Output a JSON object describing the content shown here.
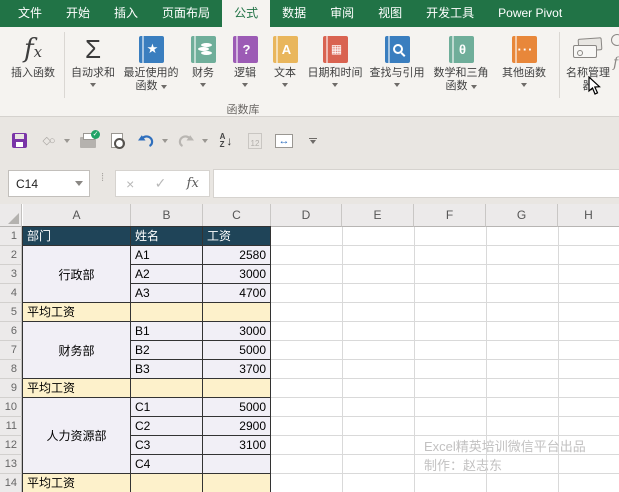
{
  "tab_bar": {
    "tabs": [
      {
        "label": "文件",
        "selected": false
      },
      {
        "label": "开始",
        "selected": false
      },
      {
        "label": "插入",
        "selected": false
      },
      {
        "label": "页面布局",
        "selected": false
      },
      {
        "label": "公式",
        "selected": true
      },
      {
        "label": "数据",
        "selected": false
      },
      {
        "label": "审阅",
        "selected": false
      },
      {
        "label": "视图",
        "selected": false
      },
      {
        "label": "开发工具",
        "selected": false
      },
      {
        "label": "Power Pivot",
        "selected": false
      }
    ]
  },
  "ribbon": {
    "group_label": "函数库",
    "buttons": {
      "insert_function": "插入函数",
      "autosum": "自动求和",
      "recent": "最近使用的函数",
      "financial": "财务",
      "logical": "逻辑",
      "text": "文本",
      "datetime": "日期和时间",
      "lookup": "查找与引用",
      "math": "数学和三角函数",
      "more": "其他函数",
      "name_manager": "名称管理器"
    },
    "icons": [
      "fx-icon",
      "sigma-autosum-icon",
      "book-star-icon",
      "book-coins-icon",
      "book-question-icon",
      "book-letter-a-icon",
      "book-calendar-icon",
      "book-magnifier-icon",
      "book-theta-icon",
      "book-ellipsis-icon",
      "name-tags-icon"
    ]
  },
  "quick_access": {
    "icons": [
      "save-icon",
      "shapes-icon",
      "print-icon",
      "print-preview-icon",
      "undo-icon",
      "redo-icon",
      "sort-az-icon",
      "paste-number-icon",
      "column-width-icon",
      "customize-toolbar-icon"
    ]
  },
  "formula_bar": {
    "name_box": "C14",
    "formula": "",
    "fx_label": "fx",
    "cancel_glyph": "×",
    "enter_glyph": "✓"
  },
  "grid": {
    "column_headers": [
      "A",
      "B",
      "C",
      "D",
      "E",
      "F",
      "G",
      "H"
    ],
    "row_headers": [
      "1",
      "2",
      "3",
      "4",
      "5",
      "6",
      "7",
      "8",
      "9",
      "10",
      "11",
      "12",
      "13",
      "14"
    ]
  },
  "sheet": {
    "table_headers": {
      "department": "部门",
      "name": "姓名",
      "salary": "工资"
    },
    "average_label": "平均工资",
    "groups": [
      {
        "department": "行政部",
        "employees": [
          {
            "name": "A1",
            "salary": "2580"
          },
          {
            "name": "A2",
            "salary": "3000"
          },
          {
            "name": "A3",
            "salary": "4700"
          }
        ]
      },
      {
        "department": "财务部",
        "employees": [
          {
            "name": "B1",
            "salary": "3000"
          },
          {
            "name": "B2",
            "salary": "5000"
          },
          {
            "name": "B3",
            "salary": "3700"
          }
        ]
      },
      {
        "department": "人力资源部",
        "employees": [
          {
            "name": "C1",
            "salary": "5000"
          },
          {
            "name": "C2",
            "salary": "2900"
          },
          {
            "name": "C3",
            "salary": "3100"
          },
          {
            "name": "C4",
            "salary": ""
          }
        ]
      }
    ]
  },
  "watermark": {
    "line1": "Excel精英培训微信平台出品",
    "line2": "制作：赵志东"
  },
  "colors": {
    "tab_green": "#217346",
    "table_header_bg": "#1f4458",
    "dept_cell_bg": "#f1eff6",
    "avg_row_bg": "#fdf1cb"
  }
}
